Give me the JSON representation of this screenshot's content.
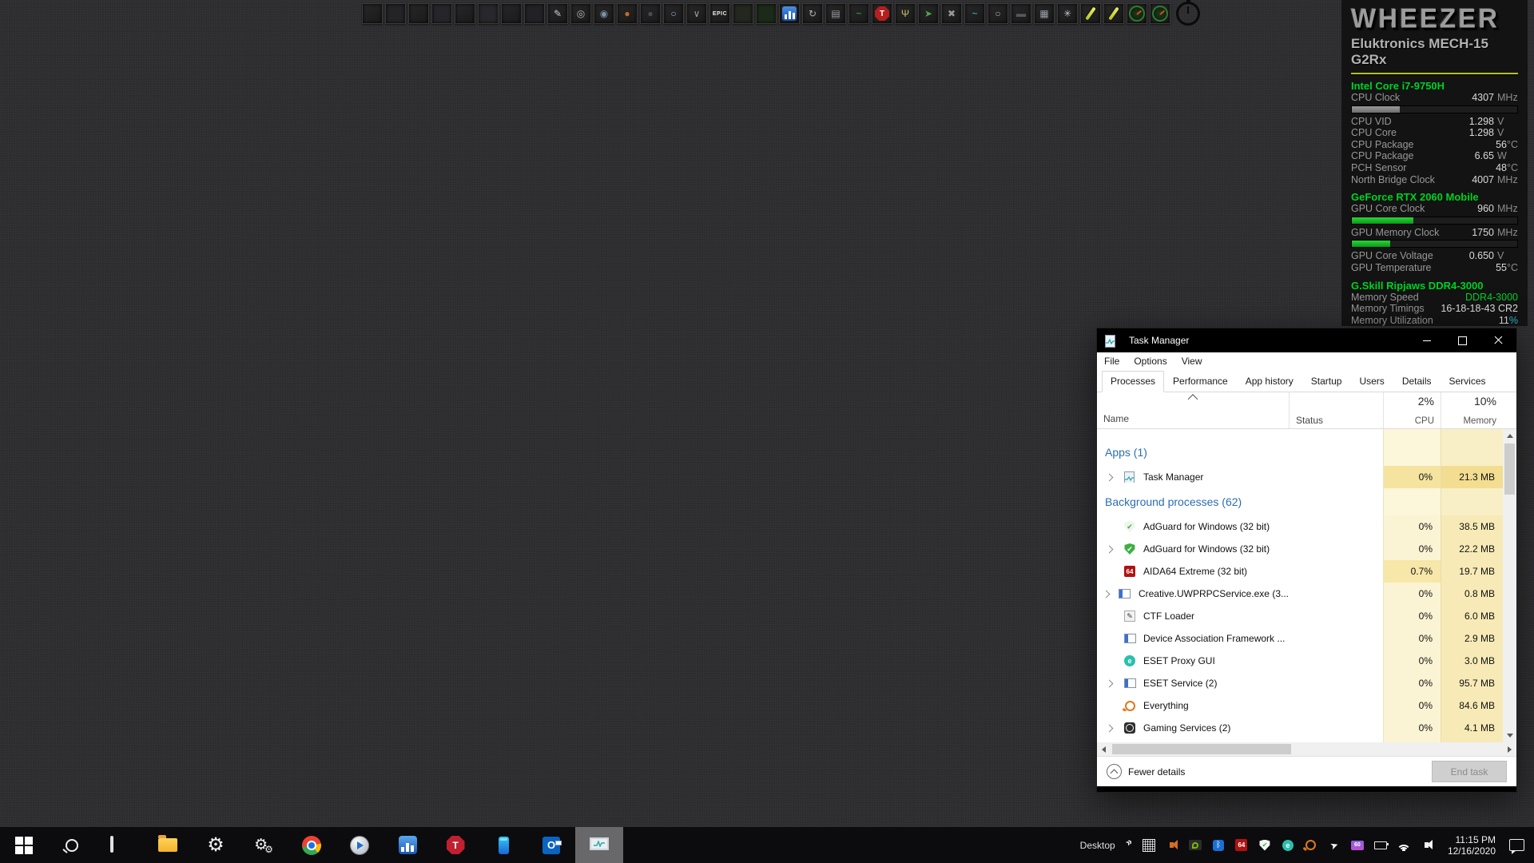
{
  "sensor_panel": {
    "logo": "WHEEZER",
    "model": "Eluktronics MECH-15 G2Rx",
    "sections": [
      {
        "header": "Intel Core i7-9750H",
        "rows": [
          {
            "label": "CPU Clock",
            "value": "4307",
            "unit": "MHz",
            "bar": {
              "pct": 29,
              "color": "#9a9a9a",
              "color2": "#6e6e6e"
            }
          },
          {
            "label": "CPU VID",
            "value": "1.298",
            "unit": "V"
          },
          {
            "label": "CPU Core",
            "value": "1.298",
            "unit": "V"
          },
          {
            "label": "CPU Package",
            "value": "56",
            "unit": "°C"
          },
          {
            "label": "CPU Package",
            "value": "6.65",
            "unit": "W"
          },
          {
            "label": "PCH Sensor",
            "value": "48",
            "unit": "°C"
          },
          {
            "label": "North Bridge Clock",
            "value": "4007",
            "unit": "MHz"
          }
        ]
      },
      {
        "header": "GeForce RTX 2060 Mobile",
        "rows": [
          {
            "label": "GPU Core Clock",
            "value": "960",
            "unit": "MHz",
            "bar": {
              "pct": 37,
              "color": "#2bd23a",
              "color2": "#0a9a18"
            }
          },
          {
            "label": "GPU Memory Clock",
            "value": "1750",
            "unit": "MHz",
            "bar": {
              "pct": 23,
              "color": "#2bd23a",
              "color2": "#0a9a18"
            }
          },
          {
            "label": "GPU Core Voltage",
            "value": "0.650",
            "unit": "V"
          },
          {
            "label": "GPU Temperature",
            "value": "55",
            "unit": "°C"
          }
        ]
      },
      {
        "header": "G.Skill Ripjaws DDR4-3000",
        "rows": [
          {
            "label": "Memory Speed",
            "value": "DDR4-3000",
            "unit": "",
            "value_color": "#00d02a"
          },
          {
            "label": "Memory Timings",
            "value": "16-18-18-43 CR2",
            "unit": ""
          },
          {
            "label": "Memory Utilization",
            "value": "11",
            "unit": "%",
            "unit_color": "#2fb3c9"
          }
        ]
      }
    ]
  },
  "window": {
    "title": "Task Manager",
    "menu": [
      "File",
      "Options",
      "View"
    ],
    "tabs": [
      {
        "label": "Processes",
        "active": true
      },
      {
        "label": "Performance",
        "active": false
      },
      {
        "label": "App history",
        "active": false
      },
      {
        "label": "Startup",
        "active": false
      },
      {
        "label": "Users",
        "active": false
      },
      {
        "label": "Details",
        "active": false
      },
      {
        "label": "Services",
        "active": false
      }
    ],
    "columns": {
      "name": "Name",
      "status": "Status",
      "cpu_pct": "2%",
      "cpu": "CPU",
      "mem_pct": "10%",
      "mem": "Memory"
    },
    "groups": [
      {
        "header": "Apps (1)",
        "rows": [
          {
            "name": "Task Manager",
            "chevron": true,
            "icon": "taskmgr",
            "status": "",
            "cpu": "0%",
            "memory": "21.3 MB",
            "hot": true
          }
        ]
      },
      {
        "header": "Background processes (62)",
        "rows": [
          {
            "name": "AdGuard for Windows (32 bit)",
            "icon": "adguard_outline",
            "status": "",
            "cpu": "0%",
            "memory": "38.5 MB"
          },
          {
            "name": "AdGuard for Windows (32 bit)",
            "chevron": true,
            "icon": "adguard_solid",
            "status": "",
            "cpu": "0%",
            "memory": "22.2 MB"
          },
          {
            "name": "AIDA64 Extreme (32 bit)",
            "icon": "aida64",
            "status": "",
            "cpu": "0.7%",
            "memory": "19.7 MB",
            "cpu_hot": true
          },
          {
            "name": "Creative.UWPRPCService.exe (3...",
            "chevron": true,
            "icon": "winapp",
            "status": "",
            "cpu": "0%",
            "memory": "0.8 MB"
          },
          {
            "name": "CTF Loader",
            "icon": "ctf",
            "status": "",
            "cpu": "0%",
            "memory": "6.0 MB"
          },
          {
            "name": "Device Association Framework ...",
            "icon": "winapp",
            "status": "",
            "cpu": "0%",
            "memory": "2.9 MB"
          },
          {
            "name": "ESET Proxy GUI",
            "icon": "eset",
            "status": "",
            "cpu": "0%",
            "memory": "3.0 MB"
          },
          {
            "name": "ESET Service (2)",
            "chevron": true,
            "icon": "winapp",
            "status": "",
            "cpu": "0%",
            "memory": "95.7 MB"
          },
          {
            "name": "Everything",
            "icon": "everything",
            "status": "",
            "cpu": "0%",
            "memory": "84.6 MB"
          },
          {
            "name": "Gaming Services (2)",
            "chevron": true,
            "icon": "xbox",
            "status": "",
            "cpu": "0%",
            "memory": "4.1 MB"
          }
        ]
      }
    ],
    "footer": {
      "toggle": "Fewer details",
      "end_task": "End task"
    }
  },
  "top_toolbar": {
    "icons": [
      {
        "name": "wallpaper-thumb-1"
      },
      {
        "name": "wallpaper-thumb-2",
        "bg": "#242428"
      },
      {
        "name": "wallpaper-thumb-3"
      },
      {
        "name": "wallpaper-thumb-4",
        "bg": "#26262a"
      },
      {
        "name": "wallpaper-thumb-5"
      },
      {
        "name": "wallpaper-thumb-6",
        "bg": "#28282c"
      },
      {
        "name": "wallpaper-thumb-7"
      },
      {
        "name": "wallpaper-thumb-8",
        "bg": "#222226"
      },
      {
        "name": "feather-pen",
        "glyph": "✎",
        "color": "#c9ced4"
      },
      {
        "name": "camera-ring",
        "glyph": "◎",
        "color": "#b4b8bc"
      },
      {
        "name": "camera-lens",
        "glyph": "◉",
        "color": "#7d93a8"
      },
      {
        "name": "orange-orb",
        "glyph": "●",
        "color": "#c06a30"
      },
      {
        "name": "dark-sphere",
        "glyph": "●",
        "color": "#474d55"
      },
      {
        "name": "uplay-power",
        "glyph": "○",
        "color": "#8fb4d8"
      },
      {
        "name": "mail-chevron",
        "glyph": "∨",
        "color": "#9a9a9a"
      },
      {
        "name": "epic-games",
        "text": "EPIC",
        "color": "#ececec"
      },
      {
        "name": "faint-logo",
        "bg": "#23271f"
      },
      {
        "name": "green-terrain",
        "bg": "#1c2a1a"
      },
      {
        "name": "hw-monitor-bars",
        "shape": "bars"
      },
      {
        "name": "sync-arrows",
        "glyph": "↻",
        "color": "#b0b0b0"
      },
      {
        "name": "data-table",
        "glyph": "▤",
        "color": "#9aa0a8"
      },
      {
        "name": "green-wave",
        "glyph": "~",
        "color": "#3fae4a"
      },
      {
        "name": "stop-t",
        "shape": "octagon",
        "text": "T"
      },
      {
        "name": "signal-antenna",
        "glyph": "Ψ",
        "color": "#c8c060"
      },
      {
        "name": "green-pointer",
        "glyph": "➤",
        "color": "#49a84f"
      },
      {
        "name": "cross-wings",
        "glyph": "✖",
        "color": "#9a9a9a"
      },
      {
        "name": "teal-waveform",
        "glyph": "~",
        "color": "#3fc8d8"
      },
      {
        "name": "ring-circle",
        "glyph": "○",
        "color": "#b8bcc2"
      },
      {
        "name": "dark-pill",
        "glyph": "▬",
        "color": "#55585c"
      },
      {
        "name": "tile-grid",
        "glyph": "▦",
        "color": "#9aa0a8"
      },
      {
        "name": "gear-burst",
        "glyph": "✳",
        "color": "#c2c6cc"
      },
      {
        "name": "yellow-pencil-1",
        "shape": "pencil"
      },
      {
        "name": "yellow-pencil-2",
        "shape": "pencil"
      },
      {
        "name": "gauge-knob-1",
        "shape": "knob"
      },
      {
        "name": "gauge-knob-2",
        "shape": "knob"
      },
      {
        "name": "stopwatch",
        "shape": "stopwatch"
      }
    ]
  },
  "taskbar": {
    "buttons": [
      {
        "name": "start"
      },
      {
        "name": "search"
      },
      {
        "name": "remote-desktop"
      },
      {
        "name": "file-explorer"
      },
      {
        "name": "settings"
      },
      {
        "name": "admin-gears"
      },
      {
        "name": "chrome"
      },
      {
        "name": "media-player"
      },
      {
        "name": "hw-stats"
      },
      {
        "name": "stop-t-app"
      },
      {
        "name": "your-phone"
      },
      {
        "name": "outlook"
      },
      {
        "name": "task-manager",
        "active": true
      }
    ],
    "tray": {
      "desktop_label": "Desktop",
      "hidden_icons_glyph": "»",
      "icons": [
        "touch-grid",
        "volume-mixer",
        "nvidia",
        "bluetooth",
        "aida64",
        "adguard",
        "eset",
        "everything",
        "pointer",
        "display-60",
        "battery",
        "wifi",
        "volume"
      ],
      "time": "11:15 PM",
      "date": "12/16/2020"
    }
  }
}
